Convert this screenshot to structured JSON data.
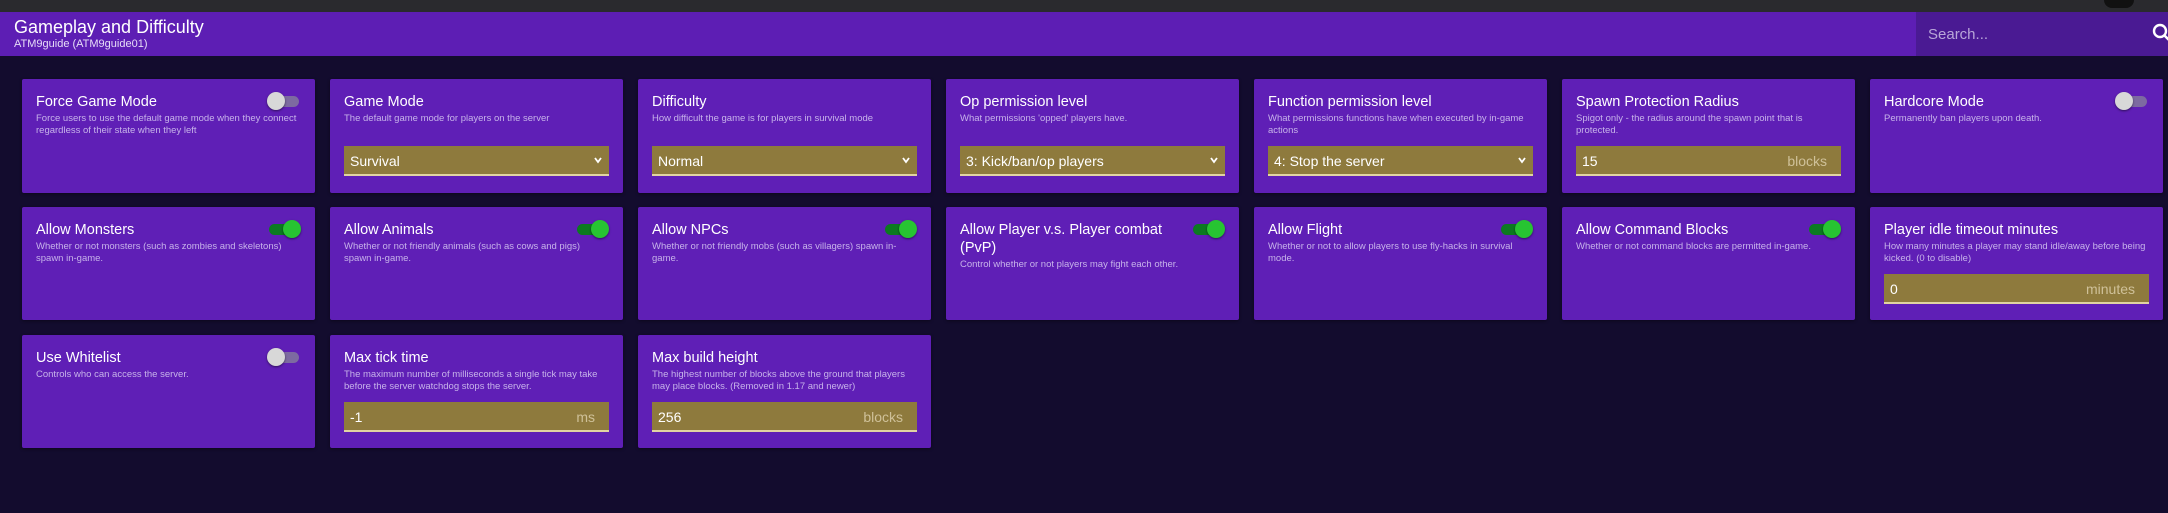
{
  "header": {
    "title": "Gameplay and Difficulty",
    "subtitle": "ATM9guide (ATM9guide01)",
    "search_placeholder": "Search...",
    "search_icon": "search-icon"
  },
  "colors": {
    "background": "#130c2e",
    "card": "#5f1fb6",
    "header": "#5d1eb4",
    "field": "#8e7a3d",
    "toggle_on": "#27c432",
    "toggle_off": "#d8d8d8"
  },
  "cards": {
    "force_game_mode": {
      "title": "Force Game Mode",
      "desc": "Force users to use the default game mode when they connect regardless of their state when they left",
      "enabled": false
    },
    "game_mode": {
      "title": "Game Mode",
      "desc": "The default game mode for players on the server",
      "value": "Survival"
    },
    "difficulty": {
      "title": "Difficulty",
      "desc": "How difficult the game is for players in survival mode",
      "value": "Normal"
    },
    "op_permission": {
      "title": "Op permission level",
      "desc": "What permissions 'opped' players have.",
      "value": "3: Kick/ban/op players"
    },
    "function_permission": {
      "title": "Function permission level",
      "desc": "What permissions functions have when executed by in-game actions",
      "value": "4: Stop the server"
    },
    "spawn_protection": {
      "title": "Spawn Protection Radius",
      "desc": "Spigot only - the radius around the spawn point that is protected.",
      "value": "15",
      "unit": "blocks"
    },
    "hardcore": {
      "title": "Hardcore Mode",
      "desc": "Permanently ban players upon death.",
      "enabled": false
    },
    "allow_monsters": {
      "title": "Allow Monsters",
      "desc": "Whether or not monsters (such as zombies and skeletons) spawn in-game.",
      "enabled": true
    },
    "allow_animals": {
      "title": "Allow Animals",
      "desc": "Whether or not friendly animals (such as cows and pigs) spawn in-game.",
      "enabled": true
    },
    "allow_npcs": {
      "title": "Allow NPCs",
      "desc": "Whether or not friendly mobs (such as villagers) spawn in-game.",
      "enabled": true
    },
    "allow_pvp": {
      "title": "Allow Player v.s. Player combat (PvP)",
      "desc": "Control whether or not players may fight each other.",
      "enabled": true
    },
    "allow_flight": {
      "title": "Allow Flight",
      "desc": "Whether or not to allow players to use fly-hacks in survival mode.",
      "enabled": true
    },
    "allow_command_blocks": {
      "title": "Allow Command Blocks",
      "desc": "Whether or not command blocks are permitted in-game.",
      "enabled": true
    },
    "idle_timeout": {
      "title": "Player idle timeout minutes",
      "desc": "How many minutes a player may stand idle/away before being kicked. (0 to disable)",
      "value": "0",
      "unit": "minutes"
    },
    "use_whitelist": {
      "title": "Use Whitelist",
      "desc": "Controls who can access the server.",
      "enabled": false
    },
    "max_tick_time": {
      "title": "Max tick time",
      "desc": "The maximum number of milliseconds a single tick may take before the server watchdog stops the server.",
      "value": "-1",
      "unit": "ms"
    },
    "max_build_height": {
      "title": "Max build height",
      "desc": "The highest number of blocks above the ground that players may place blocks. (Removed in 1.17 and newer)",
      "value": "256",
      "unit": "blocks"
    }
  }
}
